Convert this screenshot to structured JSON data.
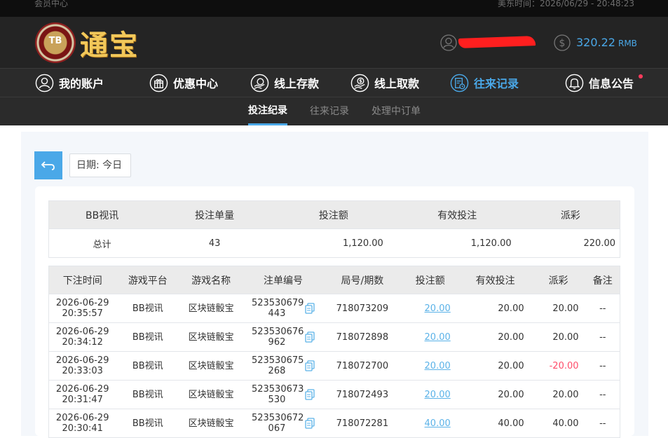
{
  "topbar": {
    "left": "会员中心",
    "right": "美东时间：2026/06/29 - 20:48:23"
  },
  "brand": {
    "logo_text": "TB",
    "name": "通宝"
  },
  "account": {
    "balance": "320.22",
    "currency": "RMB"
  },
  "nav": [
    {
      "label": "我的账户",
      "icon": "user-icon"
    },
    {
      "label": "优惠中心",
      "icon": "gift-icon"
    },
    {
      "label": "线上存款",
      "icon": "deposit-icon"
    },
    {
      "label": "线上取款",
      "icon": "withdraw-icon"
    },
    {
      "label": "往来记录",
      "icon": "records-icon",
      "active": true
    },
    {
      "label": "信息公告",
      "icon": "bell-icon"
    }
  ],
  "subnav": [
    {
      "label": "投注纪录",
      "active": true
    },
    {
      "label": "往来记录"
    },
    {
      "label": "处理中订单"
    }
  ],
  "filter": {
    "date_label": "日期: 今日"
  },
  "summary": {
    "headers": [
      "BB视讯",
      "投注单量",
      "投注额",
      "有效投注",
      "派彩"
    ],
    "row": [
      "总计",
      "43",
      "1,120.00",
      "1,120.00",
      "220.00"
    ]
  },
  "detail": {
    "headers": [
      "下注时间",
      "游戏平台",
      "游戏名称",
      "注单编号",
      "局号/期数",
      "投注额",
      "有效投注",
      "派彩",
      "备注"
    ],
    "rows": [
      {
        "date": "2026-06-29",
        "time": "20:35:57",
        "platform": "BB视讯",
        "game": "区块链骰宝",
        "order_a": "523530679",
        "order_b": "443",
        "round": "718073209",
        "bet": "20.00",
        "valid": "20.00",
        "payout": "20.00",
        "note": "--",
        "negative": false
      },
      {
        "date": "2026-06-29",
        "time": "20:34:12",
        "platform": "BB视讯",
        "game": "区块链骰宝",
        "order_a": "523530676",
        "order_b": "962",
        "round": "718072898",
        "bet": "20.00",
        "valid": "20.00",
        "payout": "20.00",
        "note": "--",
        "negative": false
      },
      {
        "date": "2026-06-29",
        "time": "20:33:03",
        "platform": "BB视讯",
        "game": "区块链骰宝",
        "order_a": "523530675",
        "order_b": "268",
        "round": "718072700",
        "bet": "20.00",
        "valid": "20.00",
        "payout": "-20.00",
        "note": "--",
        "negative": true
      },
      {
        "date": "2026-06-29",
        "time": "20:31:47",
        "platform": "BB视讯",
        "game": "区块链骰宝",
        "order_a": "523530673",
        "order_b": "530",
        "round": "718072493",
        "bet": "20.00",
        "valid": "20.00",
        "payout": "20.00",
        "note": "--",
        "negative": false
      },
      {
        "date": "2026-06-29",
        "time": "20:30:41",
        "platform": "BB视讯",
        "game": "区块链骰宝",
        "order_a": "523530672",
        "order_b": "067",
        "round": "718072281",
        "bet": "40.00",
        "valid": "40.00",
        "payout": "40.00",
        "note": "--",
        "negative": false
      }
    ]
  },
  "colors": {
    "accent": "#4aa8e8",
    "negative": "#ff4d6a",
    "brand_gold": "#f2c85a",
    "notification_dot": "#ff3b5c"
  }
}
